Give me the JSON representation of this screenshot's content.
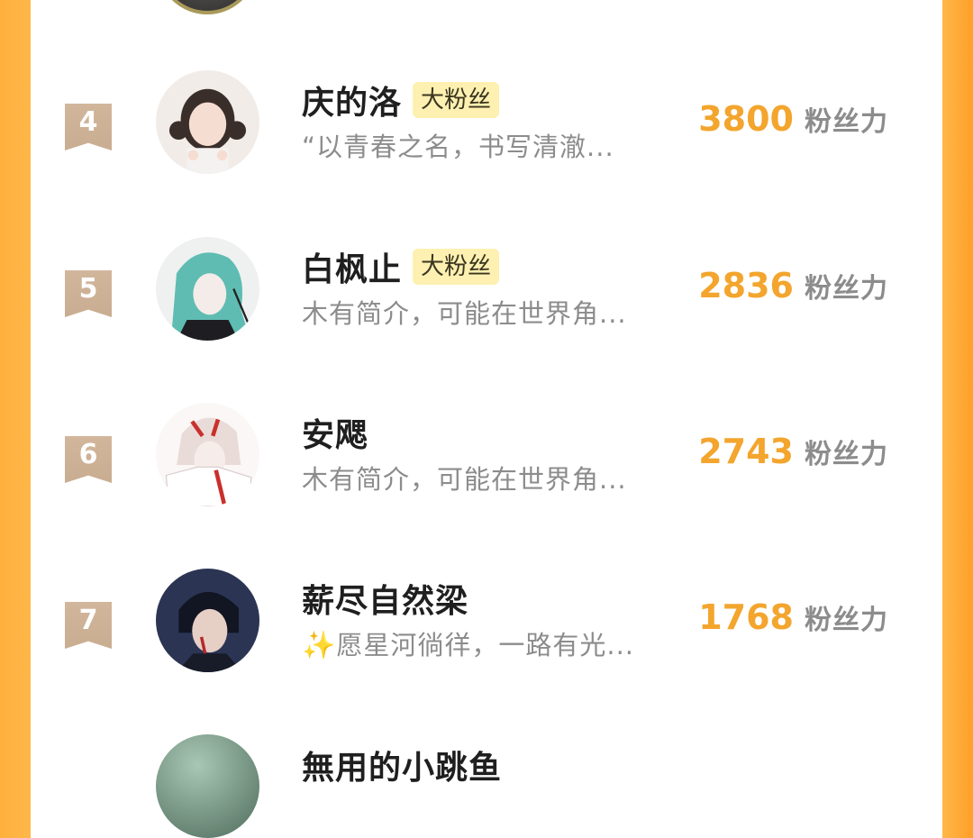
{
  "ranking": {
    "rows": [
      {
        "rank": "4",
        "name": "庆的洛",
        "badge": "大粉丝",
        "desc": "“以青春之名，书写清澈...",
        "score": "3800",
        "unit": "粉丝力"
      },
      {
        "rank": "5",
        "name": "白枫止",
        "badge": "大粉丝",
        "desc": "木有简介，可能在世界角...",
        "score": "2836",
        "unit": "粉丝力"
      },
      {
        "rank": "6",
        "name": "安飔",
        "badge": "",
        "desc": "木有简介，可能在世界角...",
        "score": "2743",
        "unit": "粉丝力"
      },
      {
        "rank": "7",
        "name": "薪尽自然梁",
        "badge": "",
        "desc_prefix": "✨",
        "desc": "愿星河徜徉，一路有光...",
        "score": "1768",
        "unit": "粉丝力"
      }
    ],
    "next_partial_name": "無用的小跳鱼"
  },
  "colors": {
    "accent": "#f3a52d",
    "badge_bg": "#fdf0b1",
    "rank_bg": "#c9ad91",
    "side": "#ffb03c"
  }
}
